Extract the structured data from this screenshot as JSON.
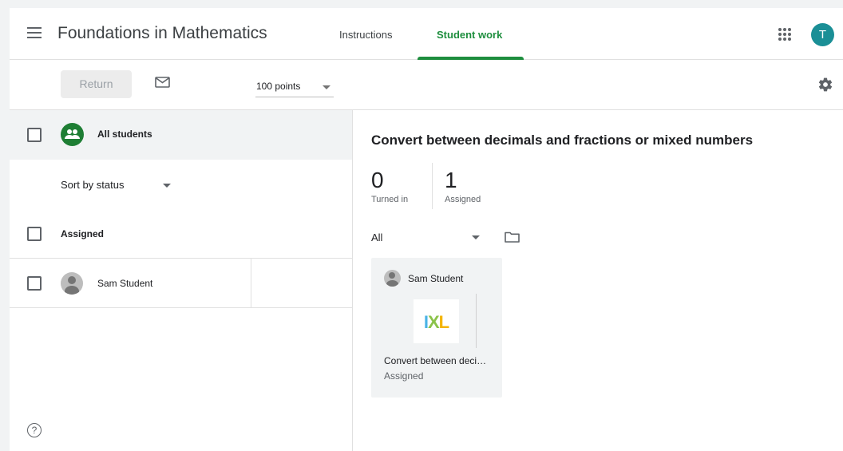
{
  "header": {
    "title": "Foundations in Mathematics",
    "tabs": [
      {
        "label": "Instructions",
        "active": false
      },
      {
        "label": "Student work",
        "active": true
      }
    ],
    "avatar_letter": "T",
    "accent_color": "#1e8e3e",
    "avatar_color": "#1a8f96"
  },
  "toolbar": {
    "return_label": "Return",
    "points_value": "100 points",
    "icons": [
      "mail-icon",
      "gear-icon"
    ]
  },
  "sidebar": {
    "all_students_label": "All students",
    "sort_label": "Sort by status",
    "group_label": "Assigned",
    "students": [
      {
        "name": "Sam Student"
      }
    ]
  },
  "main": {
    "assignment_title": "Convert between decimals and fractions or mixed numbers",
    "stats": [
      {
        "value": "0",
        "label": "Turned in"
      },
      {
        "value": "1",
        "label": "Assigned"
      }
    ],
    "filter_value": "All",
    "cards": [
      {
        "student_name": "Sam Student",
        "attachment_logo": {
          "i": "I",
          "x": "X",
          "l": "L"
        },
        "attachment_title": "Convert between deci…",
        "status": "Assigned"
      }
    ]
  },
  "help_icon": "?"
}
